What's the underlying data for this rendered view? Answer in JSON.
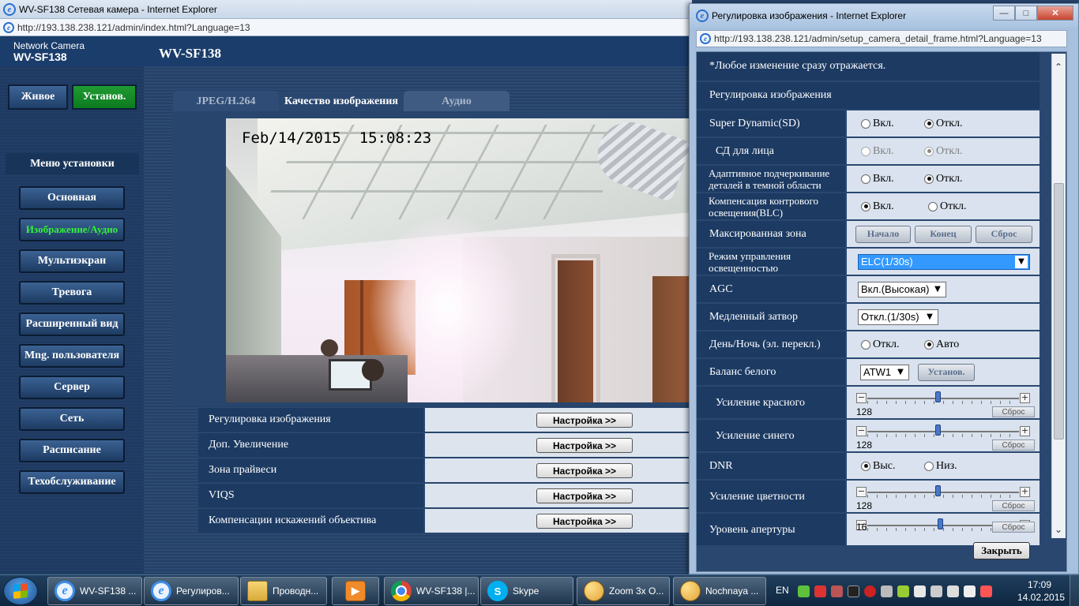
{
  "main_window": {
    "title": "WV-SF138 Сетевая камера - Internet Explorer",
    "url": "http://193.138.238.121/admin/index.html?Language=13"
  },
  "header": {
    "brand_line": "Network Camera",
    "brand_model": "WV-SF138",
    "page_model": "WV-SF138"
  },
  "mode_buttons": {
    "live": "Живое",
    "setup": "Установ."
  },
  "menu": {
    "title": "Меню установки",
    "items": [
      {
        "label": "Основная"
      },
      {
        "label": "Изображение/Аудио",
        "active": true
      },
      {
        "label": "Мультиэкран"
      },
      {
        "label": "Тревога"
      },
      {
        "label": "Расширенный вид"
      },
      {
        "label": "Mng. пользователя"
      },
      {
        "label": "Сервер"
      },
      {
        "label": "Сеть"
      },
      {
        "label": "Расписание"
      },
      {
        "label": "Техобслуживание"
      }
    ]
  },
  "tabs": [
    "JPEG/H.264",
    "Качество изображения",
    "Аудио"
  ],
  "video": {
    "timestamp": "Feb/14/2015  15:08:23"
  },
  "settings": {
    "button_label": "Настройка >>",
    "rows": [
      "Регулировка изображения",
      "Доп. Увеличение",
      "Зона прайвеси",
      "VIQS",
      "Компенсации искажений объектива"
    ]
  },
  "popup": {
    "title": "Регулировка изображения - Internet Explorer",
    "url": "http://193.138.238.121/admin/setup_camera_detail_frame.html?Language=13",
    "controls": {
      "minimize": "—",
      "maximize": "□",
      "close": "✕"
    },
    "note": "*Любое изменение сразу отражается.",
    "section": "Регулировка изображения",
    "labels": {
      "super_dynamic": "Super Dynamic(SD)",
      "face_sd": "СД для лица",
      "adaptive_1": "Адаптивное подчеркивание",
      "adaptive_2": "деталей в темной области",
      "blc_1": "Компенсация контрового",
      "blc_2": "освещения(BLC)",
      "mask_zone": "Максированная зона",
      "light_mode_1": "Режим управления",
      "light_mode_2": "освещенностью",
      "agc": "AGC",
      "slow_shutter": "Медленный затвор",
      "day_night": "День/Ночь (эл. перекл.)",
      "white_balance": "Баланс белого",
      "red_gain": "Усиление красного",
      "blue_gain": "Усиление синего",
      "dnr": "DNR",
      "chroma_gain": "Усиление цветности",
      "aperture": "Уровень апертуры"
    },
    "options": {
      "on": "Вкл.",
      "off": "Откл.",
      "auto": "Авто",
      "high": "Выс.",
      "low": "Низ."
    },
    "mask_buttons": {
      "start": "Начало",
      "end": "Конец",
      "reset": "Сброс"
    },
    "light_mode_value": "ELC(1/30s)",
    "agc_value": "Вкл.(Высокая)",
    "slow_shutter_value": "Откл.(1/30s)",
    "wb_value": "ATW1",
    "wb_button": "Установ.",
    "slider_reset": "Сброс",
    "red_gain_value": "128",
    "blue_gain_value": "128",
    "chroma_gain_value": "128",
    "aperture_value": "16",
    "close_button": "Закрыть"
  },
  "taskbar": {
    "items": [
      {
        "label": "WV-SF138 ..."
      },
      {
        "label": "Регулиров..."
      },
      {
        "label": "Проводн..."
      },
      {
        "label": "WV-SF138 |..."
      },
      {
        "label": "Skype"
      },
      {
        "label": "Zoom 3x O..."
      },
      {
        "label": "Nochnaya ..."
      }
    ],
    "lang": "EN",
    "time": "17:09",
    "date": "14.02.2015"
  },
  "accent_colors": {
    "page_bg": "#2a4770",
    "setup_green": "#1f9b32",
    "active_menu_text": "#35ef3b",
    "select_highlight": "#3399ff"
  }
}
